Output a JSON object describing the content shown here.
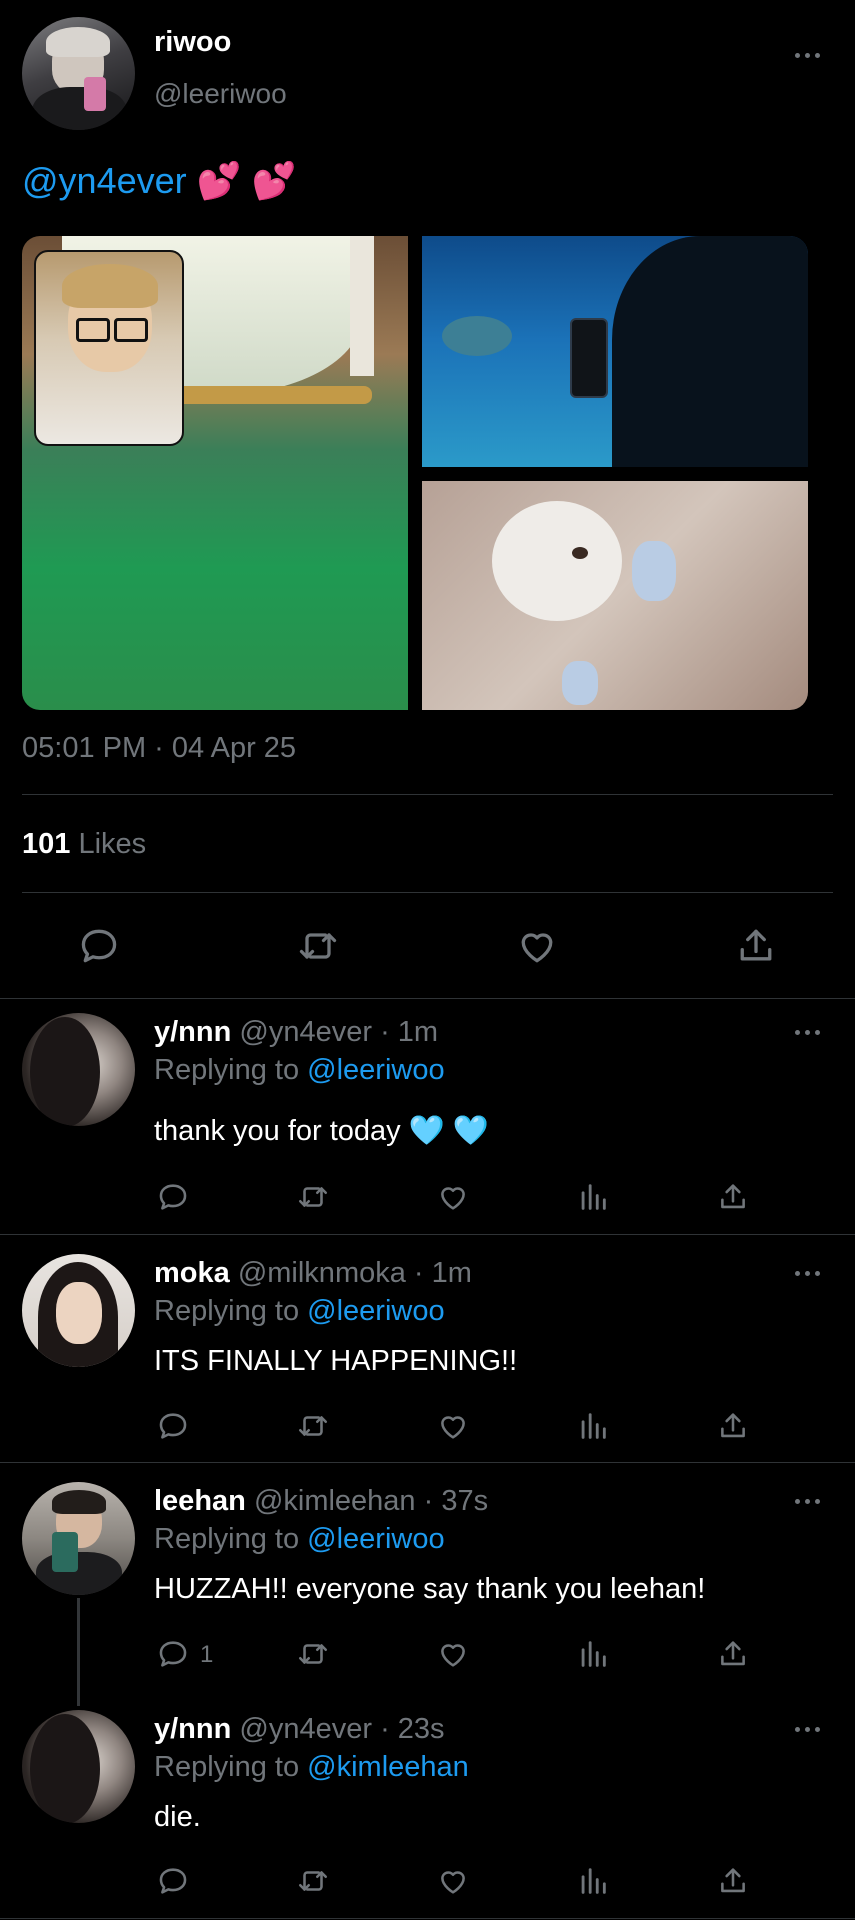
{
  "main_tweet": {
    "display_name": "riwoo",
    "handle": "@leeriwoo",
    "text_mention": "@yn4ever",
    "text_emoji": "💕 💕",
    "timestamp": "05:01 PM · 04 Apr 25",
    "likes_count": "101",
    "likes_label": "Likes",
    "media": [
      "green-drink-photo",
      "aquarium-photo",
      "otter-plush-photo"
    ]
  },
  "replies": [
    {
      "display_name": "y/nnn",
      "handle": "@yn4ever · 1m",
      "replying_prefix": "Replying to",
      "replying_to": "@leeriwoo",
      "text": "thank you for today",
      "emoji": "🩵 🩵",
      "reply_count": ""
    },
    {
      "display_name": "moka",
      "handle": "@milknmoka · 1m",
      "replying_prefix": "Replying to",
      "replying_to": "@leeriwoo",
      "text": "ITS FINALLY HAPPENING!!",
      "reply_count": ""
    },
    {
      "display_name": "leehan",
      "handle": "@kimleehan · 37s",
      "replying_prefix": "Replying to",
      "replying_to": "@leeriwoo",
      "text": "HUZZAH!! everyone say thank you leehan!",
      "reply_count": "1"
    },
    {
      "display_name": "y/nnn",
      "handle": "@yn4ever · 23s",
      "replying_prefix": "Replying to",
      "replying_to": "@kimleehan",
      "text": "die.",
      "reply_count": ""
    }
  ],
  "colors": {
    "background": "#000000",
    "accent": "#1d9bf0",
    "muted": "#71767b",
    "divider": "#2f3336"
  },
  "icons": [
    "reply-icon",
    "retweet-icon",
    "like-icon",
    "views-icon",
    "share-icon",
    "more-icon"
  ]
}
